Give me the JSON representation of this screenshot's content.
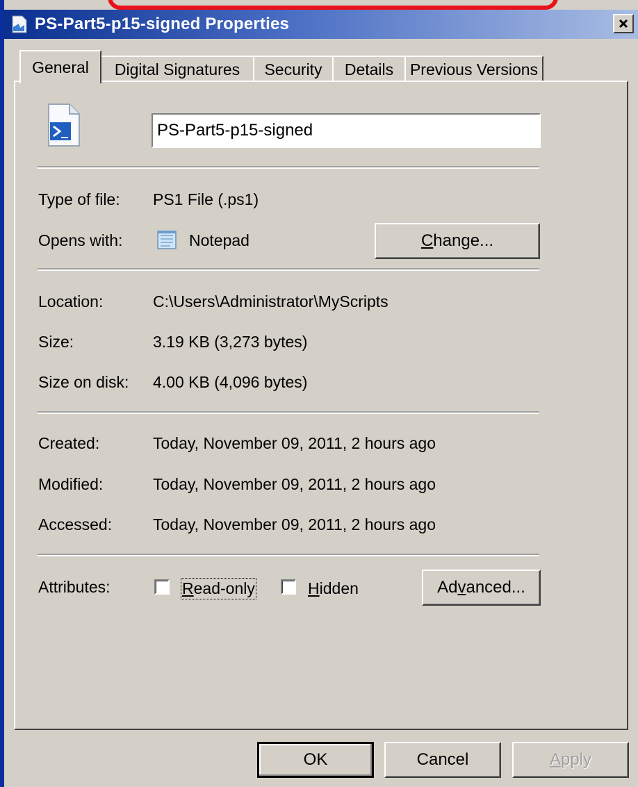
{
  "window": {
    "title": "PS-Part5-p15-signed Properties"
  },
  "tabs": [
    {
      "label": "General"
    },
    {
      "label": "Digital Signatures"
    },
    {
      "label": "Security"
    },
    {
      "label": "Details"
    },
    {
      "label": "Previous Versions"
    }
  ],
  "general": {
    "filename": "PS-Part5-p15-signed",
    "type_label": "Type of file:",
    "type_value": "PS1 File (.ps1)",
    "opens_label": "Opens with:",
    "opens_value": "Notepad",
    "change_pre": "",
    "change_accel": "C",
    "change_post": "hange...",
    "location_label": "Location:",
    "location_value": "C:\\Users\\Administrator\\MyScripts",
    "size_label": "Size:",
    "size_value": "3.19 KB (3,273 bytes)",
    "sizedisk_label": "Size on disk:",
    "sizedisk_value": "4.00 KB (4,096 bytes)",
    "created_label": "Created:",
    "created_value": "Today, November 09, 2011, 2 hours ago",
    "modified_label": "Modified:",
    "modified_value": "Today, November 09, 2011, 2 hours ago",
    "accessed_label": "Accessed:",
    "accessed_value": "Today, November 09, 2011, 2 hours ago",
    "attributes_label": "Attributes:",
    "readonly_accel": "R",
    "readonly_rest": "ead-only",
    "hidden_accel": "H",
    "hidden_rest": "idden",
    "advanced_pre": "Ad",
    "advanced_accel": "v",
    "advanced_post": "anced..."
  },
  "footer": {
    "ok": "OK",
    "cancel": "Cancel",
    "apply_accel": "A",
    "apply_rest": "pply"
  },
  "icons": {
    "title": "script-file-icon",
    "file": "powershell-file-icon",
    "opens_with": "notepad-icon",
    "close": "close-icon"
  },
  "colors": {
    "annotation": "#e8121b",
    "titlebar": "#0a2f8f"
  }
}
